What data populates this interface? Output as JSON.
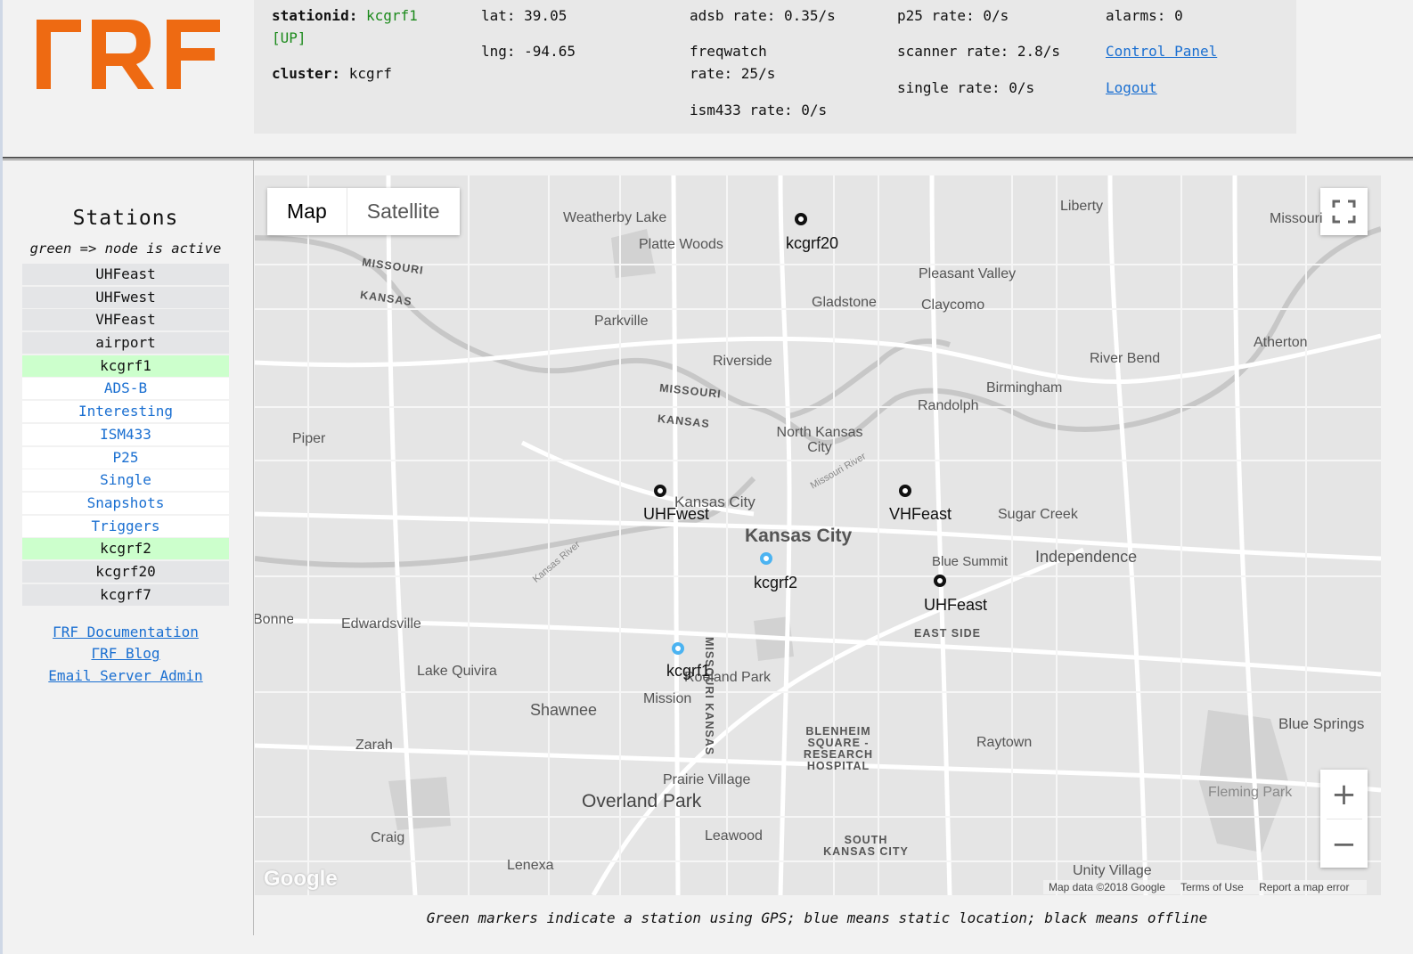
{
  "header": {
    "logo_text": "ΓRF",
    "brand_color": "#ee6a12",
    "stationid_label": "stationid:",
    "stationid_value": "kcgrf1",
    "station_state": "[UP]",
    "cluster_label": "cluster:",
    "cluster_value": "kcgrf",
    "lat": "lat: 39.05",
    "lng": "lng: -94.65",
    "adsb_rate": "adsb rate: 0.35/s",
    "freqwatch_rate_1": "freqwatch",
    "freqwatch_rate_2": "rate: 25/s",
    "ism433_rate": "ism433 rate: 0/s",
    "p25_rate": "p25 rate: 0/s",
    "scanner_rate": "scanner rate: 2.8/s",
    "single_rate": "single rate: 0/s",
    "alarms": "alarms: 0",
    "control_panel": "Control Panel",
    "logout": "Logout"
  },
  "sidebar": {
    "title": "Stations",
    "subtitle": "green => node is active",
    "items": [
      {
        "label": "UHFeast",
        "kind": "station"
      },
      {
        "label": "UHFwest",
        "kind": "station"
      },
      {
        "label": "VHFeast",
        "kind": "station"
      },
      {
        "label": "airport",
        "kind": "station"
      },
      {
        "label": "kcgrf1",
        "kind": "active"
      },
      {
        "label": "ADS-B",
        "kind": "sub"
      },
      {
        "label": "Interesting",
        "kind": "sub"
      },
      {
        "label": "ISM433",
        "kind": "sub"
      },
      {
        "label": "P25",
        "kind": "sub"
      },
      {
        "label": "Single",
        "kind": "sub"
      },
      {
        "label": "Snapshots",
        "kind": "sub"
      },
      {
        "label": "Triggers",
        "kind": "sub"
      },
      {
        "label": "kcgrf2",
        "kind": "active"
      },
      {
        "label": "kcgrf20",
        "kind": "station"
      },
      {
        "label": "kcgrf7",
        "kind": "station"
      }
    ],
    "links": [
      "ΓRF Documentation",
      "ΓRF Blog",
      "Email Server Admin"
    ]
  },
  "map": {
    "toggle_map": "Map",
    "toggle_satellite": "Satellite",
    "zoom_in": "+",
    "zoom_out": "−",
    "google_logo": "Google",
    "footer": [
      "Map data ©2018 Google",
      "Terms of Use",
      "Report a map error"
    ],
    "places": [
      "Weatherby Lake",
      "Platte Woods",
      "Liberty",
      "Missouri",
      "MISSOURI",
      "KANSAS",
      "Pleasant Valley",
      "Gladstone",
      "Claycomo",
      "Parkville",
      "Atherton",
      "Riverside",
      "River Bend",
      "Birmingham",
      "MISSOURI",
      "KANSAS",
      "Randolph",
      "North Kansas City",
      "Piper",
      "Kansas City",
      "Sugar Creek",
      "Kansas City",
      "Blue Summit",
      "Independence",
      "EAST SIDE",
      "Edwardsville",
      "Lake Quivira",
      "Roeland Park",
      "Mission",
      "Shawnee",
      "Blue Springs",
      "Zarah",
      "BLENHEIM SQUARE - RESEARCH HOSPITAL",
      "Raytown",
      "Prairie Village",
      "Fleming Park",
      "Overland Park",
      "Craig",
      "Leawood",
      "SOUTH KANSAS CITY",
      "Unity Village",
      "Lenexa",
      "Missouri River",
      "Kansas River",
      "MISSOURI KANSAS",
      "Bonner Springs"
    ],
    "markers": [
      {
        "name": "kcgrf20",
        "status": "offline"
      },
      {
        "name": "UHFwest",
        "status": "offline"
      },
      {
        "name": "VHFeast",
        "status": "offline"
      },
      {
        "name": "kcgrf2",
        "status": "static"
      },
      {
        "name": "UHFeast",
        "status": "offline"
      },
      {
        "name": "kcgrf1",
        "status": "static"
      }
    ]
  },
  "caption": "Green markers indicate a station using GPS; blue means static location; black means offline"
}
